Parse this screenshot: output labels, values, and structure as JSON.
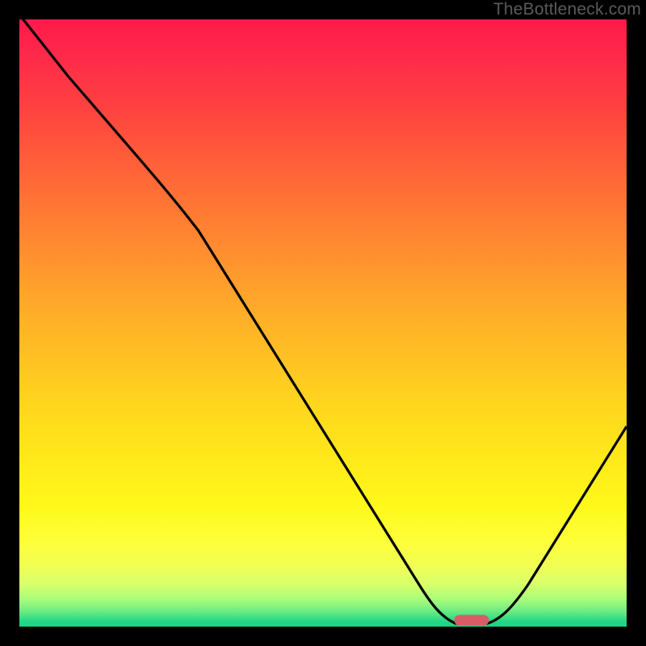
{
  "watermark": "TheBottleneck.com",
  "marker": {
    "x_pct": 74.5,
    "y_pct": 99.0
  },
  "chart_data": {
    "type": "line",
    "title": "",
    "xlabel": "",
    "ylabel": "",
    "xlim": [
      0,
      100
    ],
    "ylim": [
      0,
      100
    ],
    "grid": false,
    "legend": false,
    "x": [
      0,
      5,
      10,
      15,
      20,
      25,
      30,
      35,
      40,
      45,
      50,
      55,
      60,
      65,
      70,
      73,
      77,
      80,
      85,
      90,
      95,
      100
    ],
    "values": [
      100,
      95,
      89,
      83,
      77,
      70,
      60,
      51,
      42,
      34,
      26,
      18,
      11,
      5,
      1,
      0,
      0,
      2,
      8,
      16,
      24,
      33
    ],
    "note": "y = bottleneck percentage; curve drops to 0 around x≈73–77 then rises; marker at minimum ≈74.5"
  }
}
